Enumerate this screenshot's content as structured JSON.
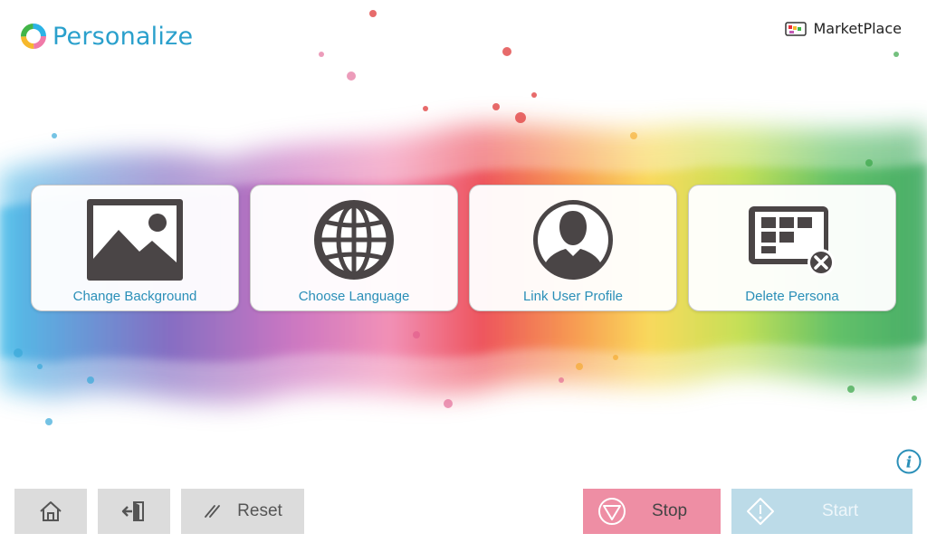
{
  "header": {
    "app_title": "Personalize",
    "brand_name": "MarketPlace"
  },
  "tiles": [
    {
      "label": "Change Background",
      "icon": "image-icon"
    },
    {
      "label": "Choose Language",
      "icon": "globe-icon"
    },
    {
      "label": "Link User Profile",
      "icon": "user-profile-icon"
    },
    {
      "label": "Delete Persona",
      "icon": "delete-persona-icon"
    }
  ],
  "footer": {
    "home_icon": "home-icon",
    "exit_icon": "exit-icon",
    "reset_label": "Reset",
    "stop_label": "Stop",
    "start_label": "Start"
  },
  "colors": {
    "title_blue": "#2aa0cc",
    "tile_label_blue": "#2a8fb8",
    "icon_dark": "#4a4546",
    "stop_pink": "#ee8ea4",
    "start_blue": "#bcdbe8",
    "button_gray": "#dcdcdc"
  }
}
